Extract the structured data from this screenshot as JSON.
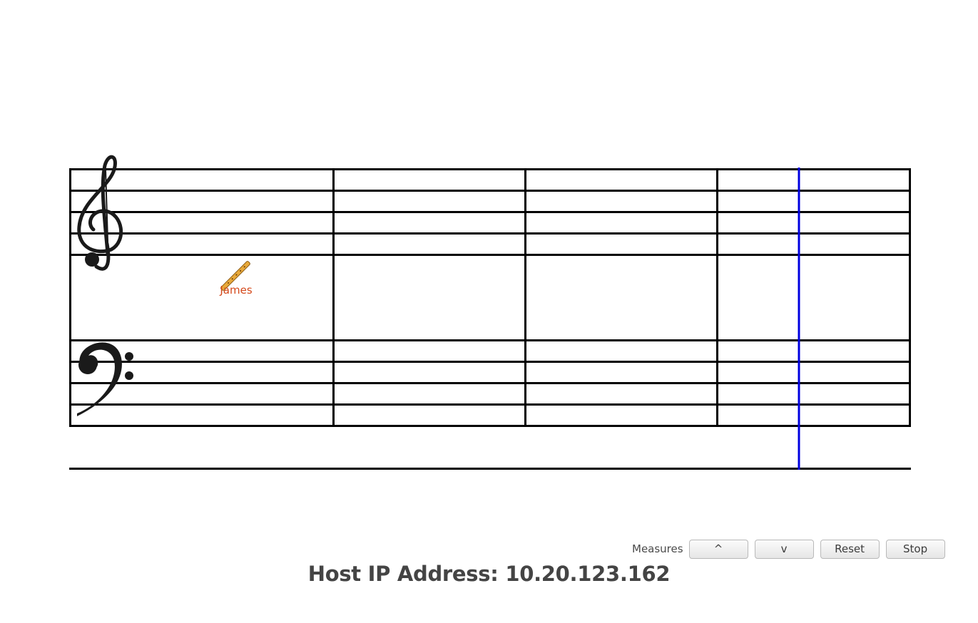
{
  "score": {
    "clefs": [
      "treble-clef",
      "bass-clef"
    ],
    "measure_count": 4,
    "playhead_color": "#0000e0",
    "staff_line_color": "#000000"
  },
  "players": [
    {
      "name": "James",
      "instrument_icon": "flute-icon",
      "color": "#d4481a"
    }
  ],
  "controls": {
    "measures_label": "Measures",
    "up_label": "^",
    "down_label": "v",
    "reset_label": "Reset",
    "stop_label": "Stop"
  },
  "footer": {
    "host_label": "Host IP Address:",
    "host_ip": "10.20.123.162"
  }
}
